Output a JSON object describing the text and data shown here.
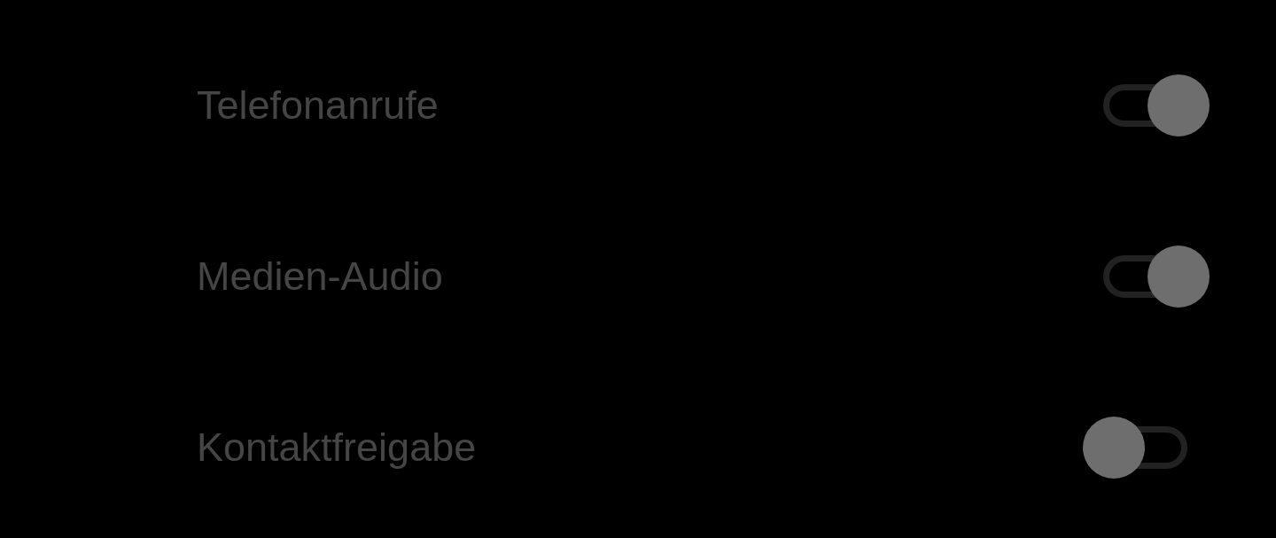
{
  "settings": [
    {
      "label": "Telefonanrufe",
      "on": true
    },
    {
      "label": "Medien-Audio",
      "on": true
    },
    {
      "label": "Kontaktfreigabe",
      "on": false
    }
  ]
}
